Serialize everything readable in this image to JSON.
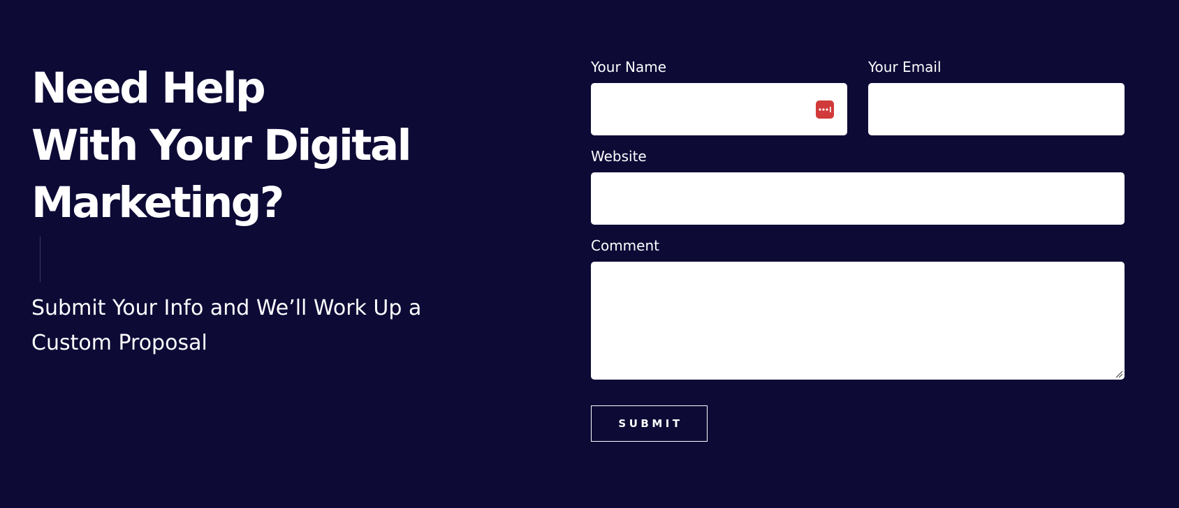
{
  "hero": {
    "headline_lines": [
      "Need Help",
      "With Your Digital",
      "Marketing?"
    ],
    "subtext": "Submit Your Info and We’ll Work Up a Custom Proposal"
  },
  "form": {
    "name": {
      "label": "Your Name",
      "value": ""
    },
    "email": {
      "label": "Your Email",
      "value": ""
    },
    "website": {
      "label": "Website",
      "value": ""
    },
    "comment": {
      "label": "Comment",
      "value": ""
    },
    "submit_label": "SUBMIT"
  },
  "icons": {
    "password_manager": "password-manager-icon",
    "resize": "resize-handle-icon"
  },
  "colors": {
    "background": "#0d0a36",
    "text": "#ffffff",
    "input_background": "#ffffff",
    "password_icon": "#d13a3a"
  }
}
